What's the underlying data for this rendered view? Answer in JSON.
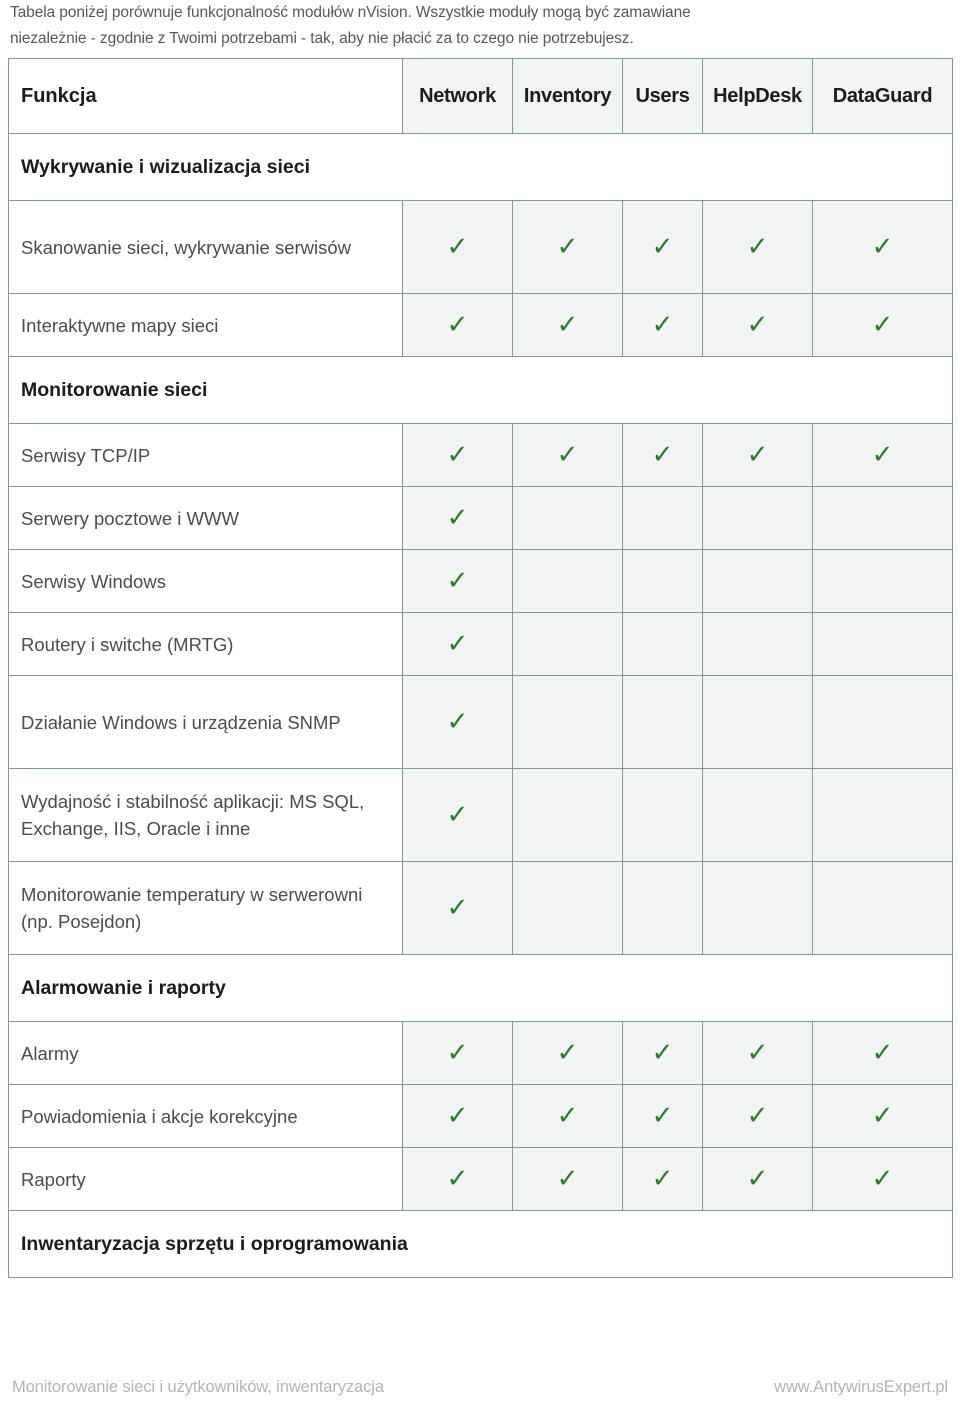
{
  "intro": {
    "line1": "Tabela poniżej porównuje funkcjonalność modułów nVision. Wszystkie moduły mogą być zamawiane",
    "line2": "niezależnie - zgodnie z Twoimi potrzebami - tak, aby nie płacić za to czego nie potrzebujesz."
  },
  "table": {
    "headers": {
      "feature": "Funkcja",
      "modules": [
        "Network",
        "Inventory",
        "Users",
        "HelpDesk",
        "DataGuard"
      ]
    },
    "check_glyph": "✓",
    "rows": [
      {
        "type": "section",
        "label": "Wykrywanie i wizualizacja sieci"
      },
      {
        "type": "feature",
        "label": "Skanowanie sieci, wykrywanie serwisów",
        "lines": 2,
        "checks": [
          true,
          true,
          true,
          true,
          true
        ]
      },
      {
        "type": "feature",
        "label": "Interaktywne mapy sieci",
        "lines": 1,
        "checks": [
          true,
          true,
          true,
          true,
          true
        ]
      },
      {
        "type": "section",
        "label": "Monitorowanie sieci"
      },
      {
        "type": "feature",
        "label": "Serwisy TCP/IP",
        "lines": 1,
        "checks": [
          true,
          true,
          true,
          true,
          true
        ]
      },
      {
        "type": "feature",
        "label": "Serwery pocztowe i WWW",
        "lines": 1,
        "checks": [
          true,
          false,
          false,
          false,
          false
        ]
      },
      {
        "type": "feature",
        "label": "Serwisy Windows",
        "lines": 1,
        "checks": [
          true,
          false,
          false,
          false,
          false
        ]
      },
      {
        "type": "feature",
        "label": "Routery i switche (MRTG)",
        "lines": 1,
        "checks": [
          true,
          false,
          false,
          false,
          false
        ]
      },
      {
        "type": "feature",
        "label": "Działanie Windows i urządzenia SNMP",
        "lines": 2,
        "checks": [
          true,
          false,
          false,
          false,
          false
        ]
      },
      {
        "type": "feature",
        "label": "Wydajność i stabilność aplikacji: MS SQL, Exchange, IIS, Oracle i inne",
        "lines": 2,
        "checks": [
          true,
          false,
          false,
          false,
          false
        ]
      },
      {
        "type": "feature",
        "label": "Monitorowanie temperatury w serwerowni (np. Posejdon)",
        "lines": 2,
        "checks": [
          true,
          false,
          false,
          false,
          false
        ]
      },
      {
        "type": "section",
        "label": "Alarmowanie i raporty"
      },
      {
        "type": "feature",
        "label": "Alarmy",
        "lines": 1,
        "checks": [
          true,
          true,
          true,
          true,
          true
        ]
      },
      {
        "type": "feature",
        "label": "Powiadomienia i akcje korekcyjne",
        "lines": 1,
        "checks": [
          true,
          true,
          true,
          true,
          true
        ]
      },
      {
        "type": "feature",
        "label": "Raporty",
        "lines": 1,
        "checks": [
          true,
          true,
          true,
          true,
          true
        ]
      },
      {
        "type": "section",
        "label": "Inwentaryzacja sprzętu i oprogramowania"
      }
    ]
  },
  "footer": {
    "left": "Monitorowanie sieci i użytkowników, inwentaryzacja",
    "right": "www.AntywirusExpert.pl"
  },
  "colors": {
    "border": "#7e9a99",
    "check_green": "#2c7a2c",
    "cell_gray": "#f2f3f3",
    "footer_text": "#b4b4b4"
  }
}
